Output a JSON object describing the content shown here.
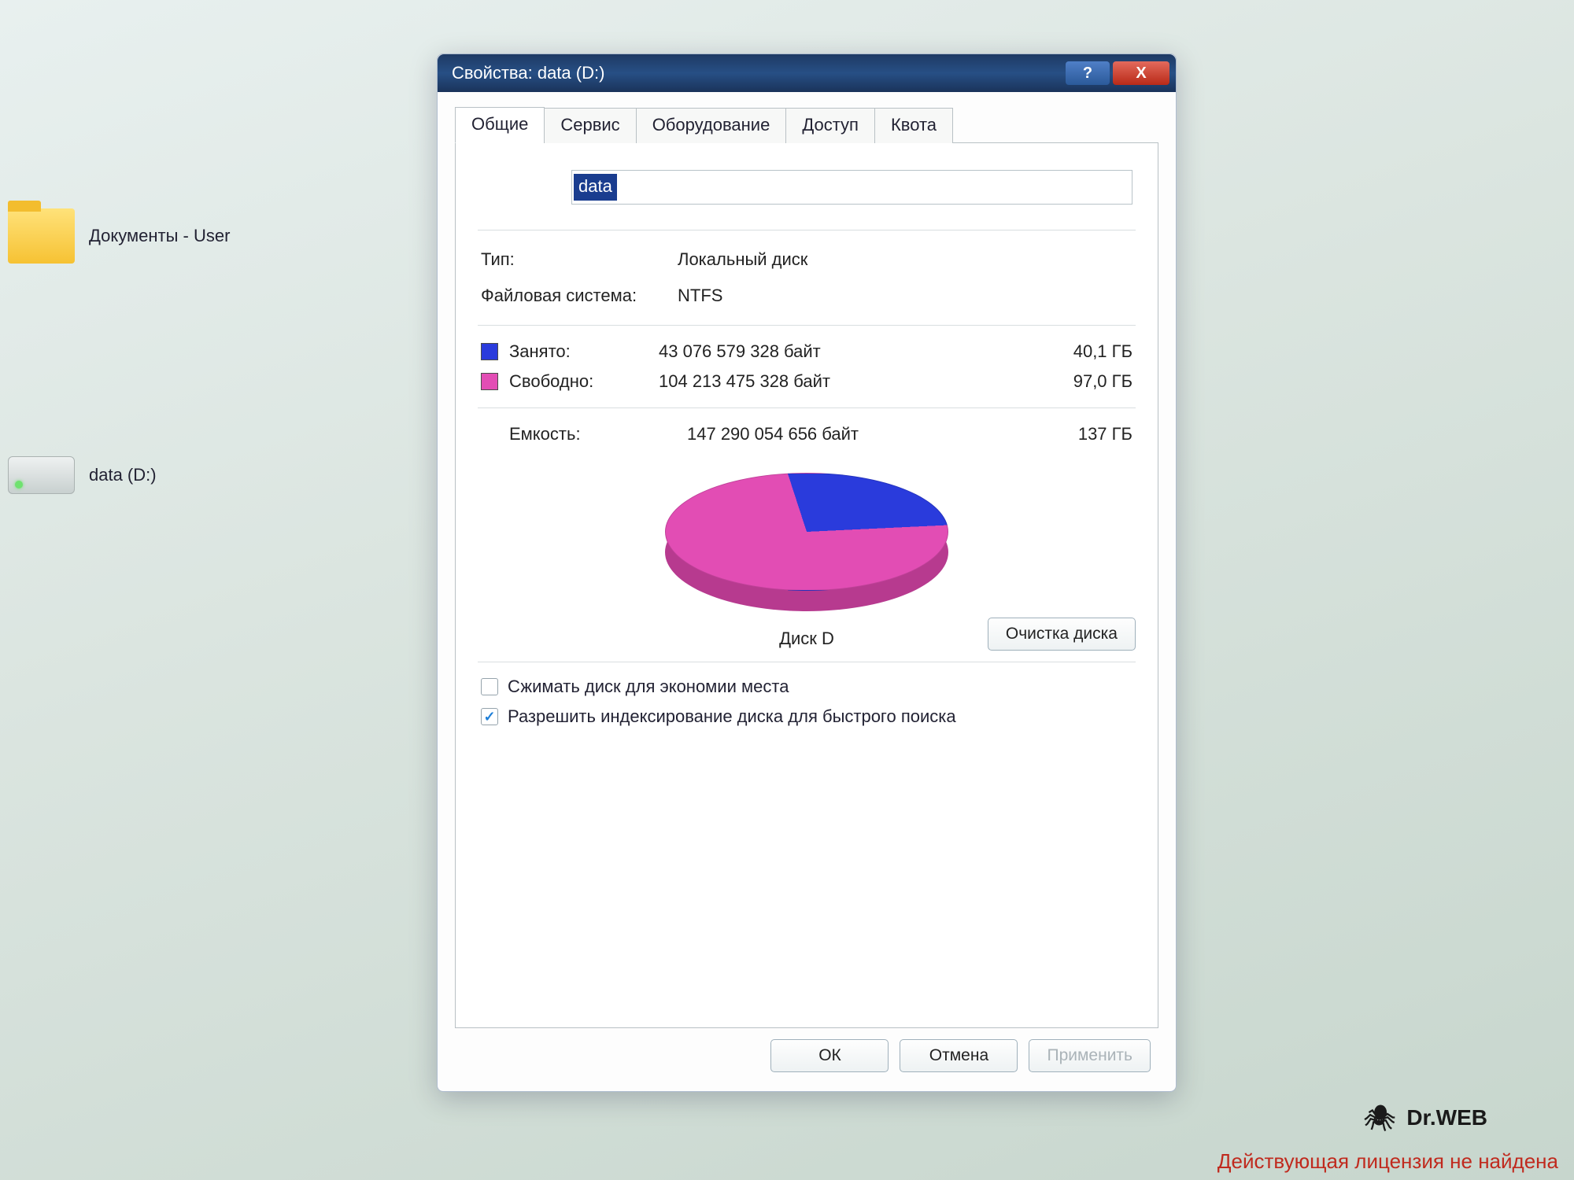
{
  "desktop": {
    "documents_label": "Документы - User",
    "drive_label": "data (D:)"
  },
  "dialog": {
    "title": "Свойства: data (D:)"
  },
  "tabs": {
    "general": "Общие",
    "tools": "Сервис",
    "hardware": "Оборудование",
    "sharing": "Доступ",
    "quota": "Квота"
  },
  "general": {
    "drive_name": "data",
    "type_label": "Тип:",
    "type_value": "Локальный диск",
    "filesystem_label": "Файловая система:",
    "filesystem_value": "NTFS",
    "used_label": "Занято:",
    "used_bytes": "43 076 579 328 байт",
    "used_gb": "40,1 ГБ",
    "free_label": "Свободно:",
    "free_bytes": "104 213 475 328 байт",
    "free_gb": "97,0 ГБ",
    "capacity_label": "Емкость:",
    "capacity_bytes": "147 290 054 656 байт",
    "capacity_gb": "137 ГБ",
    "pie_caption": "Диск D",
    "cleanup_button": "Очистка диска",
    "compress_label": "Сжимать диск для экономии места",
    "index_label": "Разрешить индексирование диска для быстрого поиска"
  },
  "buttons": {
    "ok": "ОК",
    "cancel": "Отмена",
    "apply": "Применить"
  },
  "branding": {
    "name": "Dr.WEB",
    "license_warning": "Действующая лицензия не найдена"
  },
  "chart_data": {
    "type": "pie",
    "title": "Диск D",
    "series": [
      {
        "name": "Занято",
        "value": 43076579328,
        "color": "#2a3bdc"
      },
      {
        "name": "Свободно",
        "value": 104213475328,
        "color": "#e24db4"
      }
    ],
    "capacity_bytes": 147290054656
  }
}
